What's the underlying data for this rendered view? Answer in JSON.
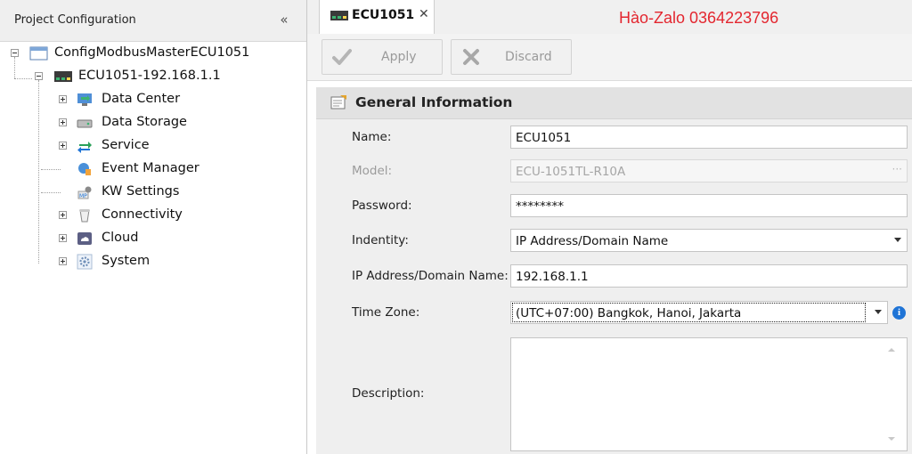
{
  "left_panel": {
    "title": "Project Configuration",
    "collapse_glyph": "«",
    "tree": {
      "root": "ConfigModbusMasterECU1051",
      "device": "ECU1051-192.168.1.1",
      "children": [
        "Data Center",
        "Data Storage",
        "Service",
        "Event Manager",
        "KW Settings",
        "Connectivity",
        "Cloud",
        "System"
      ]
    }
  },
  "tab": {
    "label": "ECU1051",
    "close_glyph": "✕"
  },
  "watermark": "Hào-Zalo 0364223796",
  "toolbar": {
    "apply_label": "Apply",
    "discard_label": "Discard"
  },
  "section": {
    "title": "General Information",
    "fields": {
      "name": {
        "label": "Name:",
        "value": "ECU1051"
      },
      "model": {
        "label": "Model:",
        "value": "ECU-1051TL-R10A",
        "button": "···"
      },
      "password": {
        "label": "Password:",
        "value": "********"
      },
      "identity": {
        "label": "Indentity:",
        "value": "IP Address/Domain Name"
      },
      "ip": {
        "label": "IP Address/Domain Name:",
        "value": "192.168.1.1"
      },
      "timezone": {
        "label": "Time Zone:",
        "value": "(UTC+07:00) Bangkok, Hanoi, Jakarta",
        "info": "i"
      },
      "description": {
        "label": "Description:",
        "value": ""
      }
    }
  },
  "colors": {
    "accent_blue": "#1f74d6",
    "watermark_red": "#e3262f",
    "device_icon_green": "#3cb371"
  }
}
